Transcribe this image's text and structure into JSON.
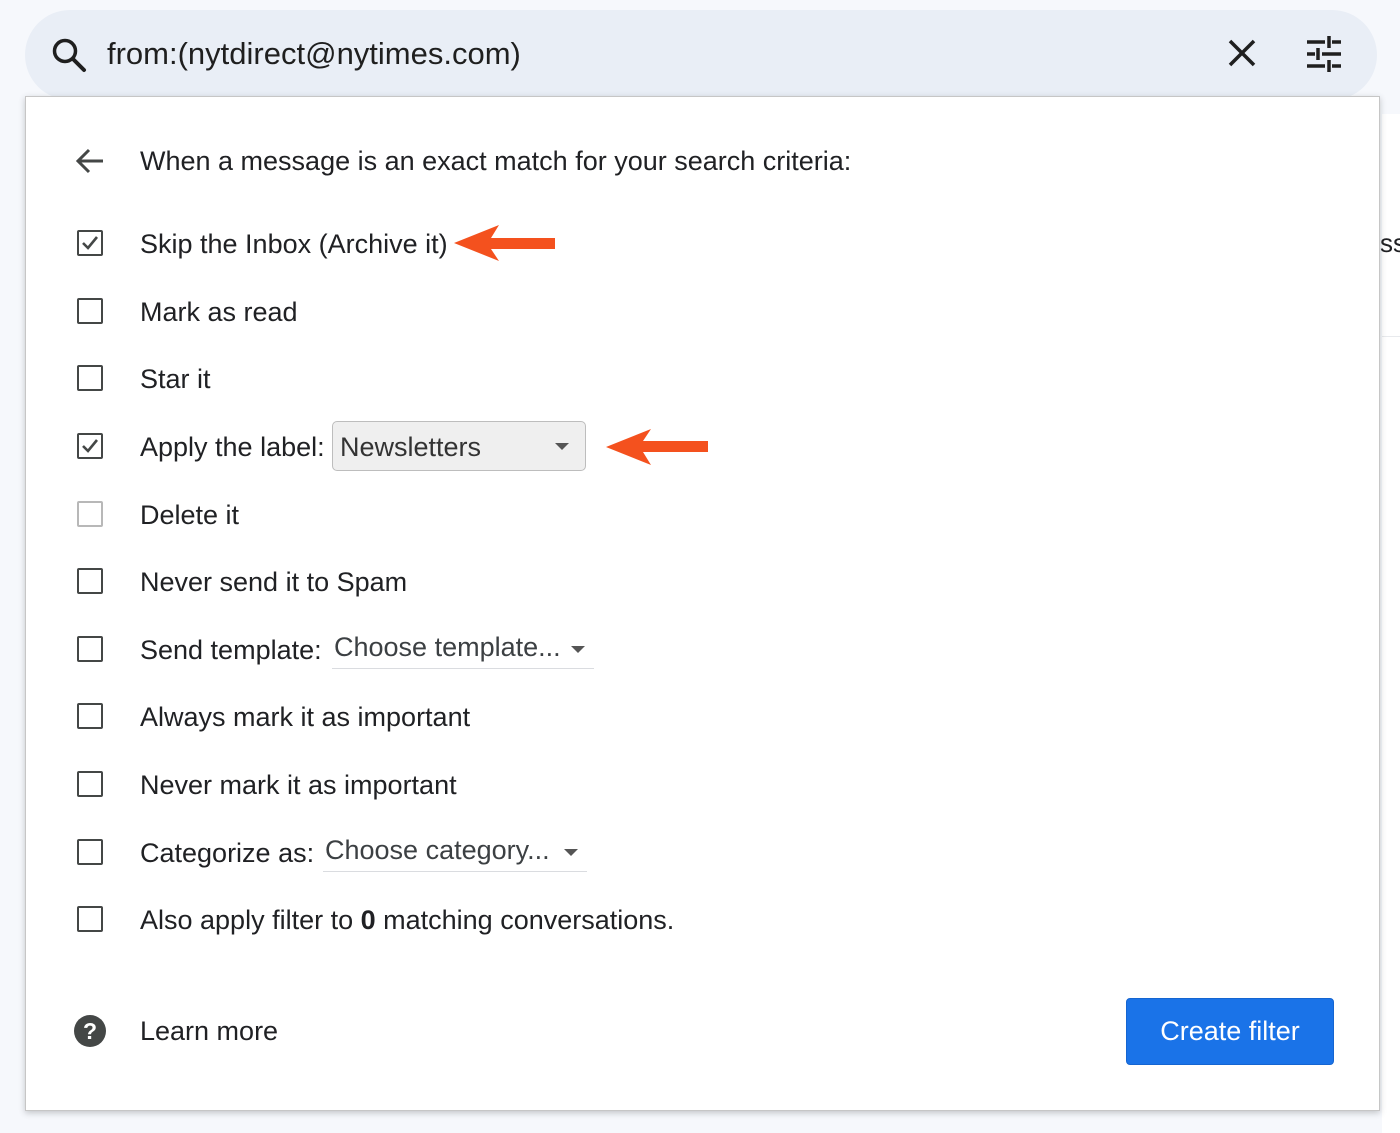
{
  "search": {
    "query": "from:(nytdirect@nytimes.com)",
    "icons": {
      "search": "search-icon",
      "clear": "close-icon",
      "options": "tune-icon"
    }
  },
  "background": {
    "partial_text": "ss"
  },
  "panel": {
    "header": "When a message is an exact match for your search criteria:",
    "options": [
      {
        "label": "Skip the Inbox (Archive it)",
        "checked": true
      },
      {
        "label": "Mark as read",
        "checked": false
      },
      {
        "label": "Star it",
        "checked": false
      },
      {
        "label": "Apply the label:",
        "checked": true
      },
      {
        "label": "Delete it",
        "checked": false,
        "disabled": true
      },
      {
        "label": "Never send it to Spam",
        "checked": false
      },
      {
        "label": "Send template:",
        "checked": false
      },
      {
        "label": "Always mark it as important",
        "checked": false
      },
      {
        "label": "Never mark it as important",
        "checked": false
      },
      {
        "label": "Categorize as:",
        "checked": false
      },
      {
        "label_before": "Also apply filter to ",
        "count": "0",
        "label_after": " matching conversations.",
        "checked": false
      }
    ],
    "label_select": {
      "value": "Newsletters"
    },
    "template_select": {
      "value": "Choose template..."
    },
    "category_select": {
      "value": "Choose category..."
    },
    "footer": {
      "learn_more": "Learn more",
      "create_filter": "Create filter"
    }
  },
  "colors": {
    "accent": "#1a73e8",
    "annotation_arrow": "#f4511e",
    "search_bar_bg": "#e9eef6"
  }
}
